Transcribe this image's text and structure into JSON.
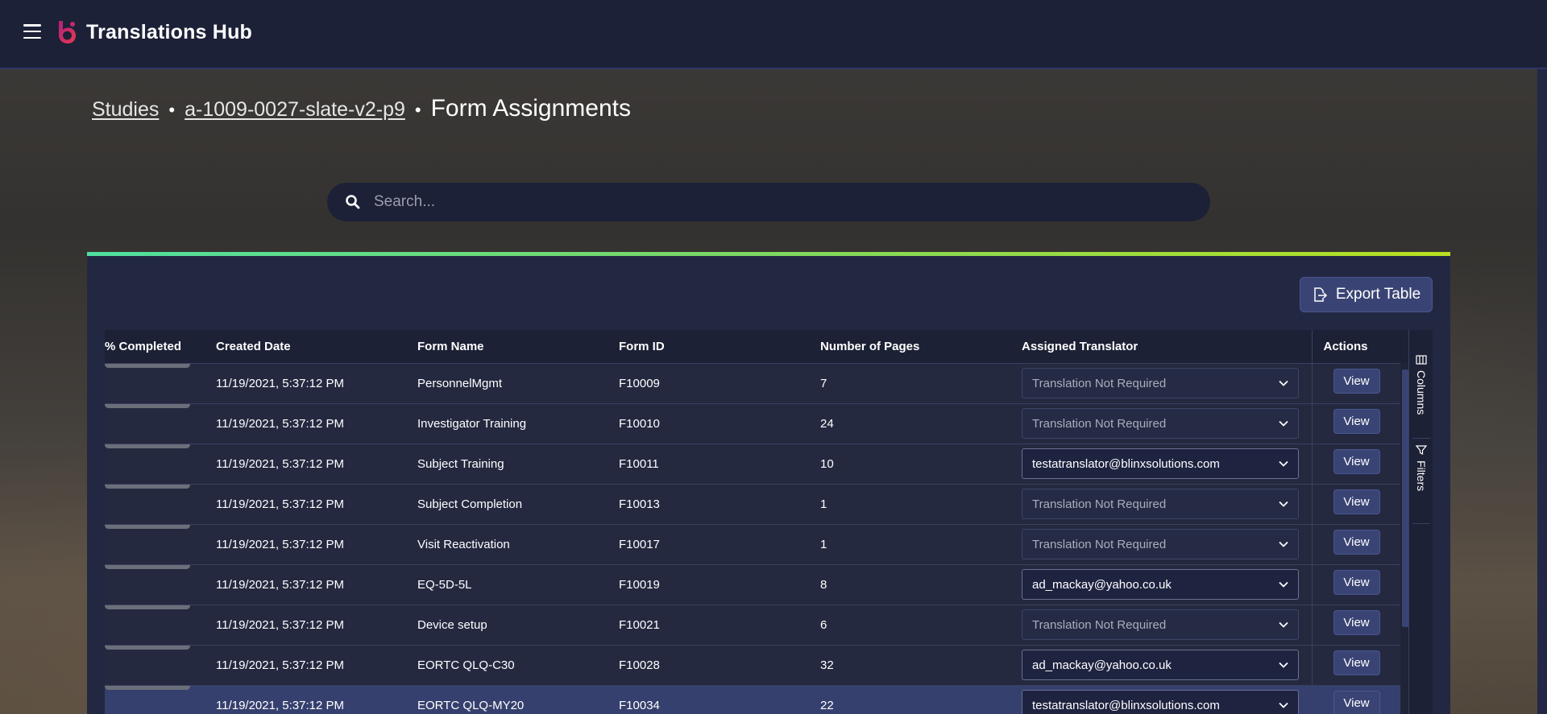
{
  "app": {
    "title": "Translations Hub"
  },
  "breadcrumb": {
    "studies": "Studies",
    "study": "a-1009-0027-slate-v2-p9",
    "current": "Form Assignments",
    "sep": "•"
  },
  "search": {
    "placeholder": "Search...",
    "value": ""
  },
  "toolbar": {
    "export_label": "Export Table"
  },
  "side_panel": {
    "columns_label": "Columns",
    "filters_label": "Filters"
  },
  "table": {
    "headers": {
      "completed": "Completed %",
      "created_date": "Created Date",
      "form_name": "Form Name",
      "form_id": "Form ID",
      "pages": "Number of Pages",
      "translator": "Assigned Translator",
      "actions": "Actions"
    },
    "view_label": "View",
    "rows": [
      {
        "date": "11/19/2021, 5:37:12 PM",
        "form": "PersonnelMgmt",
        "id": "F10009",
        "pages": "7",
        "translator": "Translation Not Required",
        "assigned": false
      },
      {
        "date": "11/19/2021, 5:37:12 PM",
        "form": "Investigator Training",
        "id": "F10010",
        "pages": "24",
        "translator": "Translation Not Required",
        "assigned": false
      },
      {
        "date": "11/19/2021, 5:37:12 PM",
        "form": "Subject Training",
        "id": "F10011",
        "pages": "10",
        "translator": "testatranslator@blinxsolutions.com",
        "assigned": true
      },
      {
        "date": "11/19/2021, 5:37:12 PM",
        "form": "Subject Completion",
        "id": "F10013",
        "pages": "1",
        "translator": "Translation Not Required",
        "assigned": false
      },
      {
        "date": "11/19/2021, 5:37:12 PM",
        "form": "Visit Reactivation",
        "id": "F10017",
        "pages": "1",
        "translator": "Translation Not Required",
        "assigned": false
      },
      {
        "date": "11/19/2021, 5:37:12 PM",
        "form": "EQ-5D-5L",
        "id": "F10019",
        "pages": "8",
        "translator": "ad_mackay@yahoo.co.uk",
        "assigned": true
      },
      {
        "date": "11/19/2021, 5:37:12 PM",
        "form": "Device setup",
        "id": "F10021",
        "pages": "6",
        "translator": "Translation Not Required",
        "assigned": false
      },
      {
        "date": "11/19/2021, 5:37:12 PM",
        "form": "EORTC QLQ-C30",
        "id": "F10028",
        "pages": "32",
        "translator": "ad_mackay@yahoo.co.uk",
        "assigned": true
      },
      {
        "date": "11/19/2021, 5:37:12 PM",
        "form": "EORTC QLQ-MY20",
        "id": "F10034",
        "pages": "22",
        "translator": "testatranslator@blinxsolutions.com",
        "assigned": true,
        "selected": true
      }
    ]
  },
  "colors": {
    "topbar": "#1c2137",
    "panel": "#232842",
    "accent_start": "#4fe0a0",
    "accent_end": "#b8e020",
    "button": "#3a4474",
    "selected_row": "#36406e"
  }
}
